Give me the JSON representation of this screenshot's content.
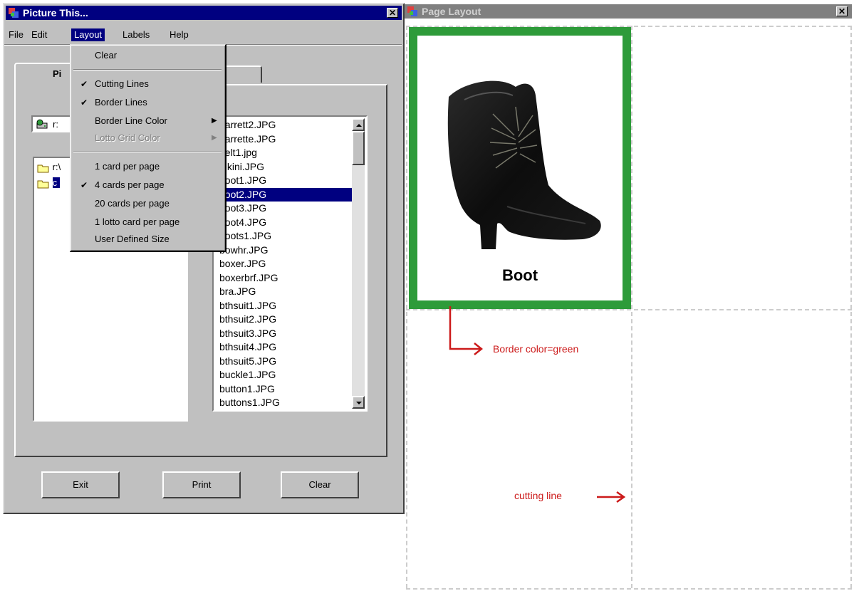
{
  "app_window": {
    "title": "Picture This...",
    "menu": [
      "File",
      "Edit",
      "Layout",
      "Labels",
      "Help"
    ],
    "active_menu": "Layout",
    "tab_label": "Pi",
    "drive_label": "r:",
    "directories": [
      "r:\\",
      "c"
    ],
    "selected_directory": "c",
    "files": [
      "barrett2.JPG",
      "barrette.JPG",
      "belt1.jpg",
      "bikini.JPG",
      "boot1.JPG",
      "boot2.JPG",
      "boot3.JPG",
      "boot4.JPG",
      "boots1.JPG",
      "bowhr.JPG",
      "boxer.JPG",
      "boxerbrf.JPG",
      "bra.JPG",
      "bthsuit1.JPG",
      "bthsuit2.JPG",
      "bthsuit3.JPG",
      "bthsuit4.JPG",
      "bthsuit5.JPG",
      "buckle1.JPG",
      "button1.JPG",
      "buttons1.JPG"
    ],
    "selected_file": "boot2.JPG",
    "buttons": {
      "exit": "Exit",
      "print": "Print",
      "clear": "Clear"
    }
  },
  "layout_menu": {
    "items": [
      {
        "label": "Clear",
        "checked": false,
        "submenu": false,
        "disabled": false
      },
      {
        "label": "Cutting Lines",
        "checked": true,
        "submenu": false,
        "disabled": false
      },
      {
        "label": "Border Lines",
        "checked": true,
        "submenu": false,
        "disabled": false
      },
      {
        "label": "Border Line Color",
        "checked": false,
        "submenu": true,
        "disabled": false
      },
      {
        "label": "Lotto Grid Color",
        "checked": false,
        "submenu": true,
        "disabled": true
      },
      {
        "label": "1 card per page",
        "checked": false,
        "submenu": false,
        "disabled": false
      },
      {
        "label": "4 cards per page",
        "checked": true,
        "submenu": false,
        "disabled": false
      },
      {
        "label": "20 cards per page",
        "checked": false,
        "submenu": false,
        "disabled": false
      },
      {
        "label": "1 lotto card per page",
        "checked": false,
        "submenu": false,
        "disabled": false
      },
      {
        "label": "User Defined Size",
        "checked": false,
        "submenu": false,
        "disabled": false
      }
    ]
  },
  "page_layout_window": {
    "title": "Page Layout",
    "card_label": "Boot",
    "border_color": "#2e9b3a",
    "annotations": {
      "border": "Border color=green",
      "cutting": "cutting line"
    }
  },
  "colors": {
    "title_active": "#000080",
    "title_inactive": "#808080",
    "selection": "#000080",
    "annotation": "#cc1a1a"
  }
}
